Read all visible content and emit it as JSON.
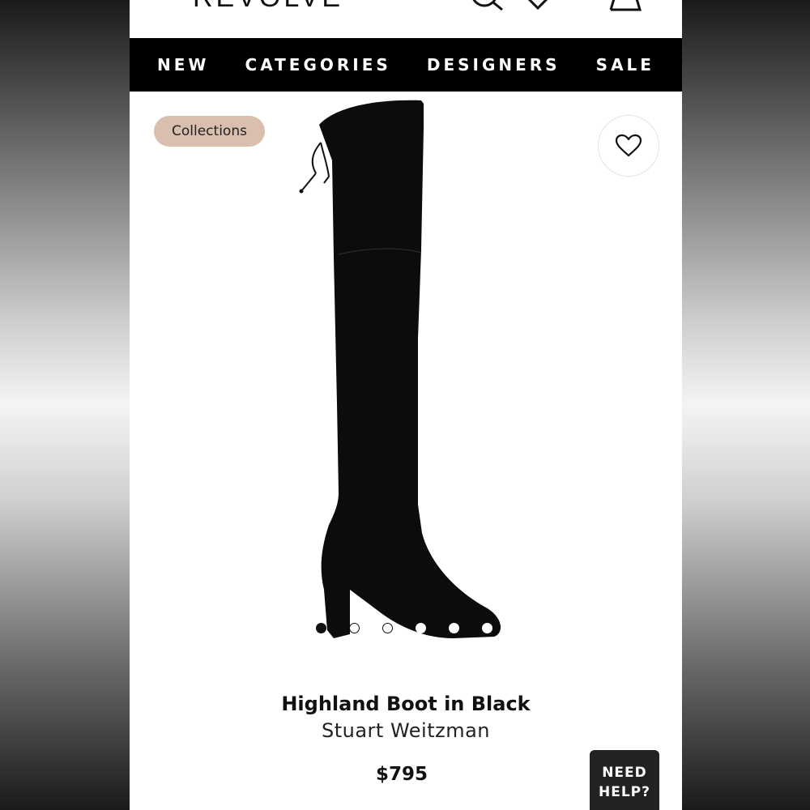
{
  "header": {
    "logo": "REVOLVE"
  },
  "nav": {
    "items": [
      {
        "label": "NEW"
      },
      {
        "label": "CATEGORIES"
      },
      {
        "label": "DESIGNERS"
      },
      {
        "label": "SALE"
      }
    ]
  },
  "product": {
    "badge": "Collections",
    "name": "Highland Boot in Black",
    "designer": "Stuart Weitzman",
    "price": "$795",
    "image_count": 6,
    "current_image": 1
  },
  "help": {
    "line1": "NEED",
    "line2": "HELP?"
  },
  "colors": {
    "nav_bg": "#000000",
    "badge_bg": "#d8bfae",
    "help_bg": "#222222"
  },
  "icons": [
    "menu-icon",
    "search-icon",
    "heart-icon",
    "bag-icon",
    "wishlist-heart-icon"
  ]
}
